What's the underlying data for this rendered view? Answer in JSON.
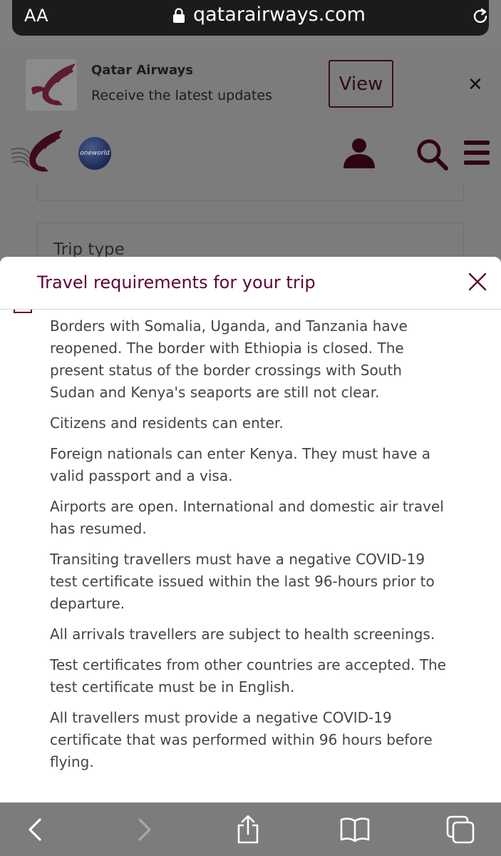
{
  "browser": {
    "text_size_label": "AA",
    "url": "qatarairways.com",
    "icons": [
      "lock-icon",
      "reload-icon"
    ]
  },
  "app_banner": {
    "app_name": "Qatar Airways",
    "subtitle": "Receive the latest updates",
    "view_label": "View",
    "close_glyph": "✕"
  },
  "site_header": {
    "partner_logo_text": "oneworld",
    "icons": [
      "qatar-airways-logo",
      "oneworld-logo",
      "user-icon",
      "search-icon",
      "menu-icon"
    ]
  },
  "background_form": {
    "trip_type_label": "Trip type"
  },
  "modal": {
    "title": "Travel requirements for your trip",
    "paragraphs": [
      "Borders with Somalia, Uganda, and Tanzania have reopened. The border with Ethiopia is closed. The present status of the border crossings with South Sudan and Kenya's seaports are still not clear.",
      "Citizens and residents can enter.",
      "Foreign nationals can enter Kenya. They must have a valid passport and a visa.",
      "Airports are open. International and domestic air travel has resumed.",
      "Transiting travellers must have a negative COVID-19 test certificate issued within the last 96-hours prior to departure.",
      "All arrivals travellers are subject to health screenings.",
      "Test certificates from other countries are accepted. The test certificate must be in English.",
      "All travellers must provide a negative COVID-19 certificate that was performed within 96 hours before flying."
    ]
  },
  "toolbar": {
    "icons": [
      "back-icon",
      "forward-icon",
      "share-icon",
      "bookmarks-icon",
      "tabs-icon"
    ]
  },
  "colors": {
    "brand": "#5c0632",
    "overlay": "#7c7c7c",
    "text": "#444444"
  }
}
